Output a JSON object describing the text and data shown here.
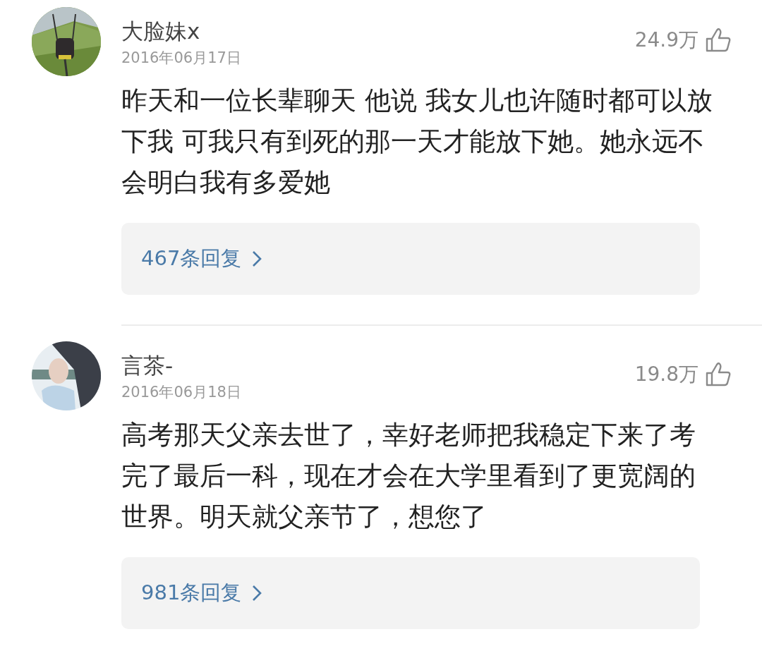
{
  "comments": [
    {
      "author": "大脸妹x",
      "date": "2016年06月17日",
      "likes": "24.9万",
      "text": "昨天和一位长辈聊天 他说 我女儿也许随时都可以放下我 可我只有到死的那一天才能放下她。她永远不会明白我有多爱她",
      "replies": "467条回复"
    },
    {
      "author": "言茶-",
      "date": "2016年06月18日",
      "likes": "19.8万",
      "text": "高考那天父亲去世了，幸好老师把我稳定下来了考完了最后一科，现在才会在大学里看到了更宽阔的世界。明天就父亲节了，想您了",
      "replies": "981条回复"
    }
  ]
}
